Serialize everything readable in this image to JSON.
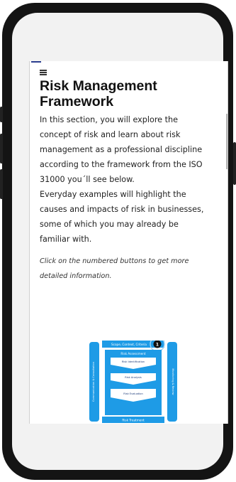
{
  "article": {
    "title": "Risk Management Framework",
    "paragraph_1": "In this section, you will explore the concept of risk and learn about risk management as a professional discipline according to the framework from the ISO 31000 you´ll see below.",
    "paragraph_2": "Everyday examples will highlight the causes and impacts of risk in businesses, some of which you may already be familiar with.",
    "hint": "Click on the numbered buttons to get more detailed information."
  },
  "diagram": {
    "top_label": "Scope, Context, Criteria",
    "button_number": "1",
    "left_label": "Communication & Consultation",
    "right_label": "Monitoring & Review",
    "assessment_label": "Risk Assessment",
    "step_1": "Risk Identification",
    "step_2": "Risk Analysis",
    "step_3": "Risk Evaluation",
    "bottom_label": "Risk Treatment"
  },
  "colors": {
    "accent": "#2b3d8f",
    "diagram_blue": "#1e9be6",
    "phone_body": "#141414"
  },
  "icons": {
    "menu": "hamburger-icon"
  }
}
